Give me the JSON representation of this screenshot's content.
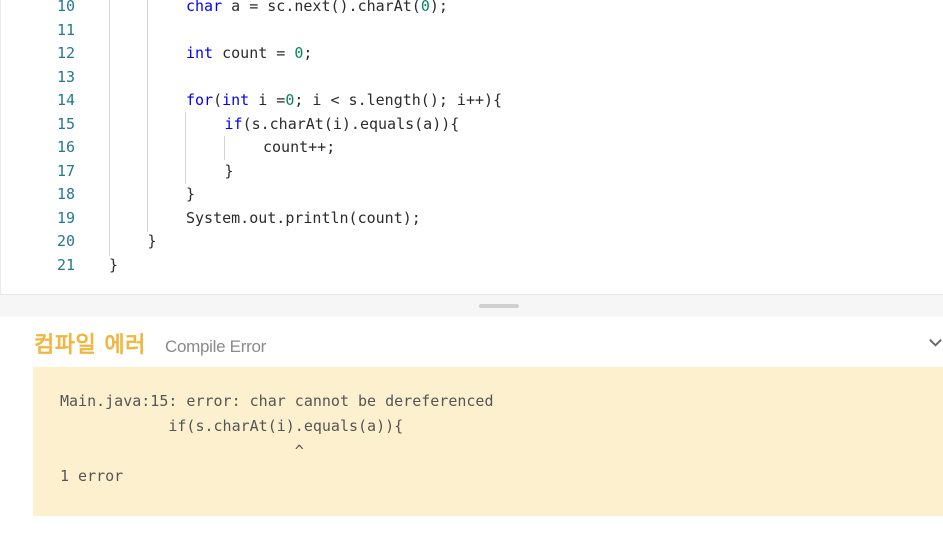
{
  "editor": {
    "lines": [
      {
        "number": "10",
        "parts": [
          {
            "t": "char",
            "c": "kw"
          },
          {
            "t": " a = sc.next().charAt("
          },
          {
            "t": "0",
            "c": "num"
          },
          {
            "t": ");"
          }
        ]
      },
      {
        "number": "11",
        "parts": []
      },
      {
        "number": "12",
        "parts": [
          {
            "t": "int",
            "c": "kw"
          },
          {
            "t": " count = "
          },
          {
            "t": "0",
            "c": "num"
          },
          {
            "t": ";"
          }
        ]
      },
      {
        "number": "13",
        "parts": []
      },
      {
        "number": "14",
        "parts": [
          {
            "t": "for",
            "c": "kw"
          },
          {
            "t": "("
          },
          {
            "t": "int",
            "c": "kw"
          },
          {
            "t": " i ="
          },
          {
            "t": "0",
            "c": "num"
          },
          {
            "t": "; i < s.length(); i++){"
          }
        ]
      },
      {
        "number": "15",
        "parts": [
          {
            "t": "if",
            "c": "kw"
          },
          {
            "t": "(s.charAt(i).equals(a)){"
          }
        ]
      },
      {
        "number": "16",
        "parts": [
          {
            "t": "count++;"
          }
        ]
      },
      {
        "number": "17",
        "parts": [
          {
            "t": "}"
          }
        ]
      },
      {
        "number": "18",
        "parts": [
          {
            "t": "}"
          }
        ]
      },
      {
        "number": "19",
        "parts": [
          {
            "t": "System.out.println(count);"
          }
        ]
      },
      {
        "number": "20",
        "parts": [
          {
            "t": "}"
          }
        ]
      },
      {
        "number": "21",
        "parts": [
          {
            "t": "}"
          }
        ]
      }
    ]
  },
  "result": {
    "title": "컴파일 에러",
    "subtitle": "Compile Error",
    "collapse_icon": "chevron-down-icon",
    "error_lines": [
      "Main.java:15: error: char cannot be dereferenced",
      "            if(s.charAt(i).equals(a)){",
      "                          ^",
      "1 error"
    ]
  },
  "colors": {
    "keyword": "#0000ff",
    "number": "#098658",
    "line_number": "#237893",
    "title": "#f2b640",
    "error_background": "#fdf0cf"
  }
}
